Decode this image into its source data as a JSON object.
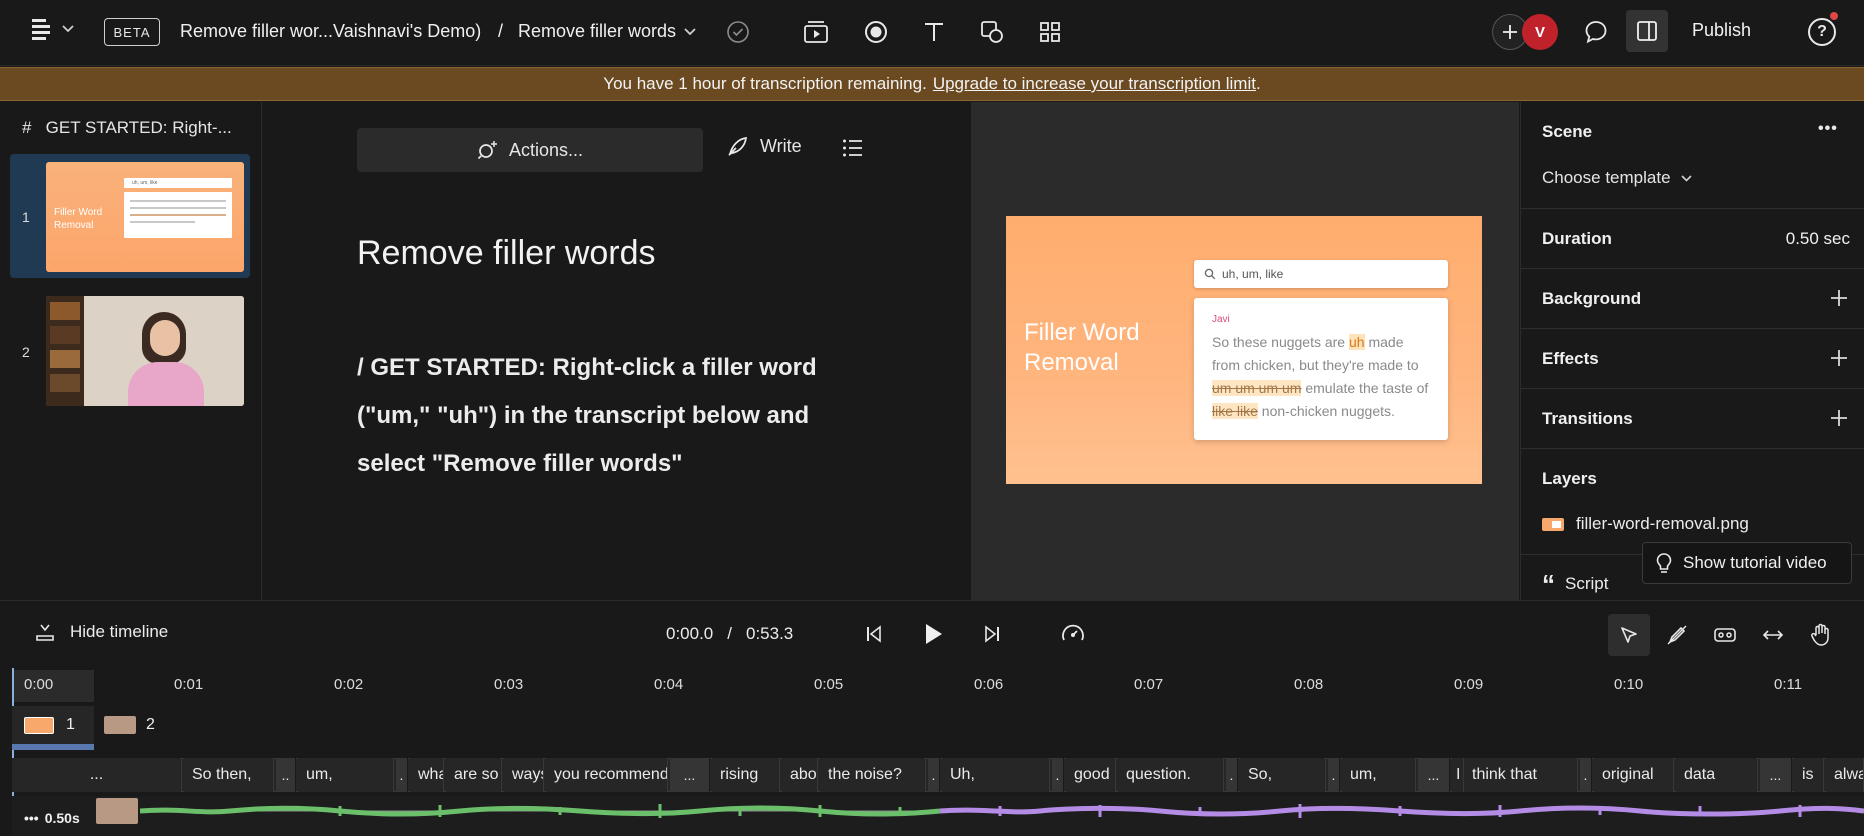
{
  "topbar": {
    "beta_label": "BETA",
    "project_title": "Remove filler wor...Vaishnavi's Demo)",
    "separator": "/",
    "composition_title": "Remove filler words",
    "avatar_initials": "V",
    "publish_label": "Publish",
    "help_label": "?"
  },
  "banner": {
    "text": "You have 1 hour of transcription remaining.",
    "link": "Upgrade to increase your transcription limit",
    "suffix": "."
  },
  "scenes": {
    "header_hash": "#",
    "header": "GET STARTED: Right-...",
    "items": [
      {
        "number": "1",
        "thumb_title": "Filler Word Removal",
        "thumb_search": "uh, um, like"
      },
      {
        "number": "2"
      }
    ]
  },
  "editor": {
    "actions_label": "Actions...",
    "write_label": "Write",
    "title": "Remove filler words",
    "body": "/ GET STARTED: Right-click a filler word (\"um,\" \"uh\") in the transcript below and select \"Remove filler words\""
  },
  "preview": {
    "canvas_title": "Filler Word Removal",
    "search_text": "uh, um, like",
    "quote_author": "Javi",
    "quote_parts": {
      "p1": "So these nuggets are ",
      "h1": "uh",
      "p2": " made from chicken, but they're made to ",
      "s1": "um um um um",
      "p3": " emulate the taste of ",
      "s2": "like like",
      "p4": " non-chicken nuggets."
    }
  },
  "properties": {
    "scene_label": "Scene",
    "more_label": "•••",
    "choose_template": "Choose template",
    "duration_label": "Duration",
    "duration_value": "0.50 sec",
    "background_label": "Background",
    "effects_label": "Effects",
    "transitions_label": "Transitions",
    "layers_label": "Layers",
    "layer_file": "filler-word-removal.png",
    "script_label": "Script",
    "tooltip": "Show tutorial video"
  },
  "timeline": {
    "hide_label": "Hide timeline",
    "current_time": "0:00.0",
    "time_sep": "/",
    "total_time": "0:53.3",
    "ruler": [
      "0:00",
      "0:01",
      "0:02",
      "0:03",
      "0:04",
      "0:05",
      "0:06",
      "0:07",
      "0:08",
      "0:09",
      "0:10",
      "0:11"
    ],
    "scene_tracks": [
      "1",
      "2"
    ],
    "duration_chip": "0.50s",
    "words": [
      "...",
      "So then,",
      "..",
      "um,",
      ".",
      "what",
      "are so",
      "ways",
      "you recommend",
      "...",
      "rising",
      "above",
      "the noise?",
      ".",
      "Uh,",
      ".",
      "good",
      "question.",
      ".",
      "So,",
      ".",
      "um,",
      "...",
      "I",
      "think that",
      ".",
      "original",
      "data",
      "...",
      "is",
      "always"
    ]
  },
  "colors": {
    "accent_blue": "#1f3a52",
    "banner": "#6b4a22",
    "canvas_orange": "#ffad6e",
    "wave_green": "#6bbf6b",
    "wave_purple": "#b48ce6",
    "avatar_red": "#c0222c"
  }
}
